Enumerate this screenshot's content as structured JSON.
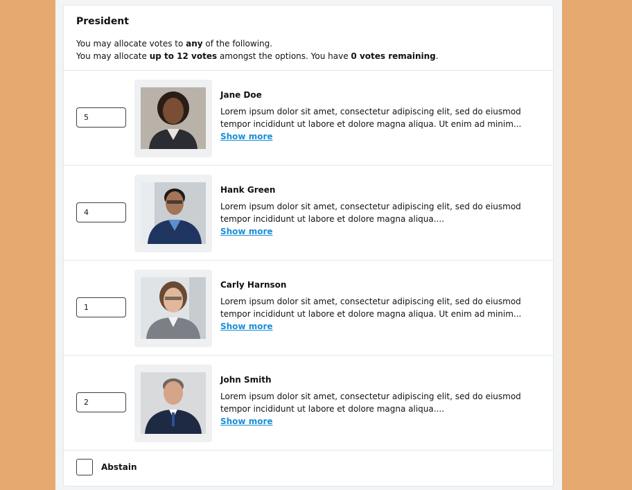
{
  "ballot": {
    "title": "President",
    "instruction_line1": {
      "pre": "You may allocate votes to ",
      "bold": "any",
      "post": " of the following."
    },
    "instruction_line2": {
      "pre": "You may allocate ",
      "bold1": "up to 12 votes",
      "mid": " amongst the options. You have ",
      "bold2": "0 votes remaining",
      "post": "."
    }
  },
  "candidates": [
    {
      "votes": "5",
      "name": "Jane Doe",
      "description_line1": "Lorem ipsum dolor sit amet, consectetur adipiscing elit, sed do eiusmod",
      "description_line2": "tempor incididunt ut labore et dolore magna aliqua. Ut enim ad minim...",
      "show_more": "Show more",
      "photo": "portrait-woman-1"
    },
    {
      "votes": "4",
      "name": "Hank Green",
      "description_line1": "Lorem ipsum dolor sit amet, consectetur adipiscing elit, sed do eiusmod",
      "description_line2": "tempor incididunt ut labore et dolore magna aliqua....",
      "show_more": "Show more",
      "photo": "portrait-man-1"
    },
    {
      "votes": "1",
      "name": "Carly Harnson",
      "description_line1": "Lorem ipsum dolor sit amet, consectetur adipiscing elit, sed do eiusmod",
      "description_line2": "tempor incididunt ut labore et dolore magna aliqua. Ut enim ad minim...",
      "show_more": "Show more",
      "photo": "portrait-woman-2"
    },
    {
      "votes": "2",
      "name": "John Smith",
      "description_line1": "Lorem ipsum dolor sit amet, consectetur adipiscing elit, sed do eiusmod",
      "description_line2": "tempor incididunt ut labore et dolore magna aliqua....",
      "show_more": "Show more",
      "photo": "portrait-man-2"
    }
  ],
  "abstain": {
    "label": "Abstain",
    "checked": false
  },
  "colors": {
    "page_background": "#e6aa70",
    "link": "#1a8fd8"
  }
}
